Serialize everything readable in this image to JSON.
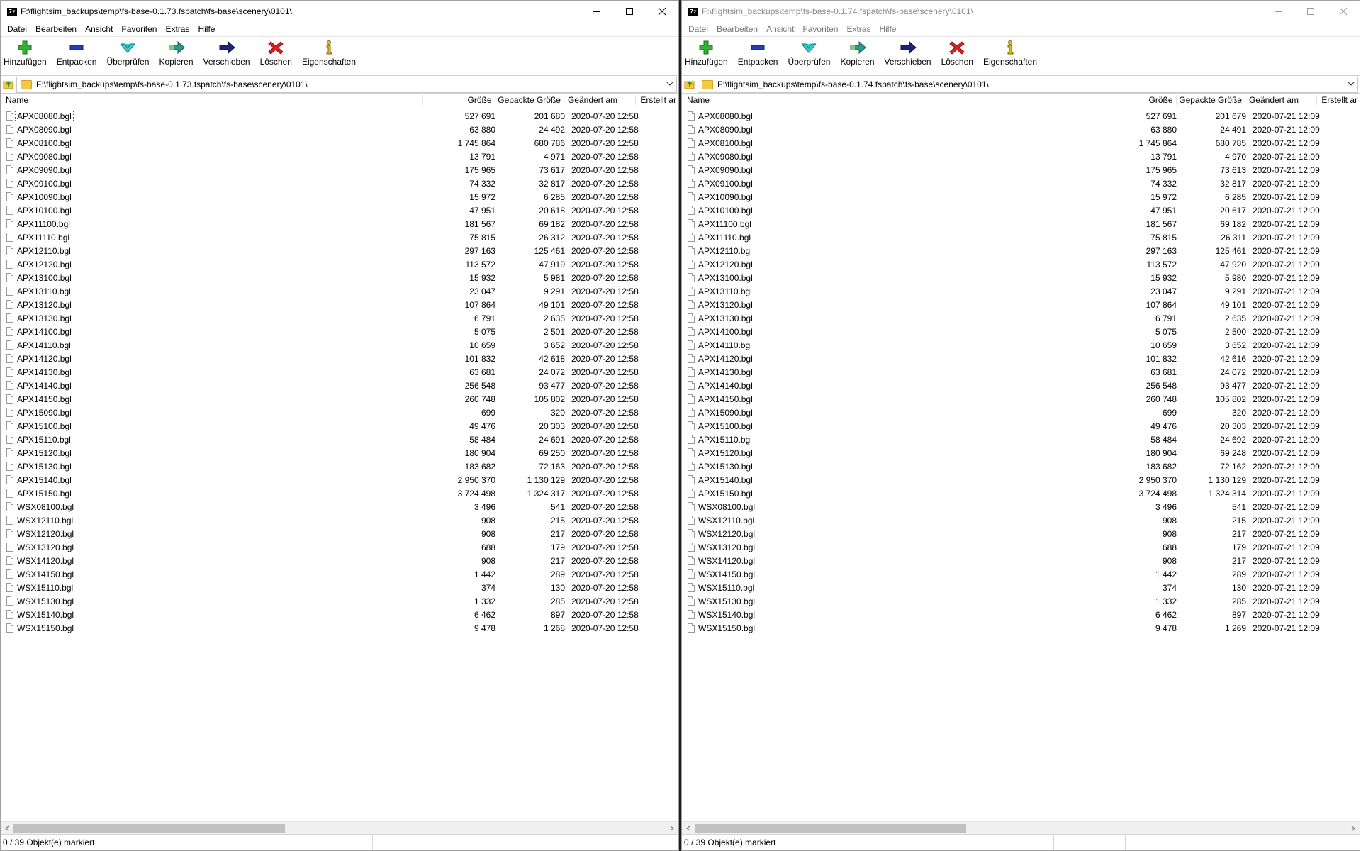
{
  "columns": {
    "name": "Name",
    "size": "Größe",
    "packed": "Gepackte Größe",
    "modified": "Geändert am",
    "created": "Erstellt ar"
  },
  "menu": [
    "Datei",
    "Bearbeiten",
    "Ansicht",
    "Favoriten",
    "Extras",
    "Hilfe"
  ],
  "toolbar": [
    "Hinzufügen",
    "Entpacken",
    "Überprüfen",
    "Kopieren",
    "Verschieben",
    "Löschen",
    "Eigenschaften"
  ],
  "app_icon_text": "7z",
  "left": {
    "title": "F:\\flightsim_backups\\temp\\fs-base-0.1.73.fspatch\\fs-base\\scenery\\0101\\",
    "address": "F:\\flightsim_backups\\temp\\fs-base-0.1.73.fspatch\\fs-base\\scenery\\0101\\",
    "status": "0 / 39 Objekt(e) markiert",
    "rows": [
      [
        "APX08080.bgl",
        "527 691",
        "201 680",
        "2020-07-20 12:58"
      ],
      [
        "APX08090.bgl",
        "63 880",
        "24 492",
        "2020-07-20 12:58"
      ],
      [
        "APX08100.bgl",
        "1 745 864",
        "680 786",
        "2020-07-20 12:58"
      ],
      [
        "APX09080.bgl",
        "13 791",
        "4 971",
        "2020-07-20 12:58"
      ],
      [
        "APX09090.bgl",
        "175 965",
        "73 617",
        "2020-07-20 12:58"
      ],
      [
        "APX09100.bgl",
        "74 332",
        "32 817",
        "2020-07-20 12:58"
      ],
      [
        "APX10090.bgl",
        "15 972",
        "6 285",
        "2020-07-20 12:58"
      ],
      [
        "APX10100.bgl",
        "47 951",
        "20 618",
        "2020-07-20 12:58"
      ],
      [
        "APX11100.bgl",
        "181 567",
        "69 182",
        "2020-07-20 12:58"
      ],
      [
        "APX11110.bgl",
        "75 815",
        "26 312",
        "2020-07-20 12:58"
      ],
      [
        "APX12110.bgl",
        "297 163",
        "125 461",
        "2020-07-20 12:58"
      ],
      [
        "APX12120.bgl",
        "113 572",
        "47 919",
        "2020-07-20 12:58"
      ],
      [
        "APX13100.bgl",
        "15 932",
        "5 981",
        "2020-07-20 12:58"
      ],
      [
        "APX13110.bgl",
        "23 047",
        "9 291",
        "2020-07-20 12:58"
      ],
      [
        "APX13120.bgl",
        "107 864",
        "49 101",
        "2020-07-20 12:58"
      ],
      [
        "APX13130.bgl",
        "6 791",
        "2 635",
        "2020-07-20 12:58"
      ],
      [
        "APX14100.bgl",
        "5 075",
        "2 501",
        "2020-07-20 12:58"
      ],
      [
        "APX14110.bgl",
        "10 659",
        "3 652",
        "2020-07-20 12:58"
      ],
      [
        "APX14120.bgl",
        "101 832",
        "42 618",
        "2020-07-20 12:58"
      ],
      [
        "APX14130.bgl",
        "63 681",
        "24 072",
        "2020-07-20 12:58"
      ],
      [
        "APX14140.bgl",
        "256 548",
        "93 477",
        "2020-07-20 12:58"
      ],
      [
        "APX14150.bgl",
        "260 748",
        "105 802",
        "2020-07-20 12:58"
      ],
      [
        "APX15090.bgl",
        "699",
        "320",
        "2020-07-20 12:58"
      ],
      [
        "APX15100.bgl",
        "49 476",
        "20 303",
        "2020-07-20 12:58"
      ],
      [
        "APX15110.bgl",
        "58 484",
        "24 691",
        "2020-07-20 12:58"
      ],
      [
        "APX15120.bgl",
        "180 904",
        "69 250",
        "2020-07-20 12:58"
      ],
      [
        "APX15130.bgl",
        "183 682",
        "72 163",
        "2020-07-20 12:58"
      ],
      [
        "APX15140.bgl",
        "2 950 370",
        "1 130 129",
        "2020-07-20 12:58"
      ],
      [
        "APX15150.bgl",
        "3 724 498",
        "1 324 317",
        "2020-07-20 12:58"
      ],
      [
        "WSX08100.bgl",
        "3 496",
        "541",
        "2020-07-20 12:58"
      ],
      [
        "WSX12110.bgl",
        "908",
        "215",
        "2020-07-20 12:58"
      ],
      [
        "WSX12120.bgl",
        "908",
        "217",
        "2020-07-20 12:58"
      ],
      [
        "WSX13120.bgl",
        "688",
        "179",
        "2020-07-20 12:58"
      ],
      [
        "WSX14120.bgl",
        "908",
        "217",
        "2020-07-20 12:58"
      ],
      [
        "WSX14150.bgl",
        "1 442",
        "289",
        "2020-07-20 12:58"
      ],
      [
        "WSX15110.bgl",
        "374",
        "130",
        "2020-07-20 12:58"
      ],
      [
        "WSX15130.bgl",
        "1 332",
        "285",
        "2020-07-20 12:58"
      ],
      [
        "WSX15140.bgl",
        "6 462",
        "897",
        "2020-07-20 12:58"
      ],
      [
        "WSX15150.bgl",
        "9 478",
        "1 268",
        "2020-07-20 12:58"
      ]
    ]
  },
  "right": {
    "title": "F:\\flightsim_backups\\temp\\fs-base-0.1.74.fspatch\\fs-base\\scenery\\0101\\",
    "address": "F:\\flightsim_backups\\temp\\fs-base-0.1.74.fspatch\\fs-base\\scenery\\0101\\",
    "status": "0 / 39 Objekt(e) markiert",
    "rows": [
      [
        "APX08080.bgl",
        "527 691",
        "201 679",
        "2020-07-21 12:09"
      ],
      [
        "APX08090.bgl",
        "63 880",
        "24 491",
        "2020-07-21 12:09"
      ],
      [
        "APX08100.bgl",
        "1 745 864",
        "680 785",
        "2020-07-21 12:09"
      ],
      [
        "APX09080.bgl",
        "13 791",
        "4 970",
        "2020-07-21 12:09"
      ],
      [
        "APX09090.bgl",
        "175 965",
        "73 613",
        "2020-07-21 12:09"
      ],
      [
        "APX09100.bgl",
        "74 332",
        "32 817",
        "2020-07-21 12:09"
      ],
      [
        "APX10090.bgl",
        "15 972",
        "6 285",
        "2020-07-21 12:09"
      ],
      [
        "APX10100.bgl",
        "47 951",
        "20 617",
        "2020-07-21 12:09"
      ],
      [
        "APX11100.bgl",
        "181 567",
        "69 182",
        "2020-07-21 12:09"
      ],
      [
        "APX11110.bgl",
        "75 815",
        "26 311",
        "2020-07-21 12:09"
      ],
      [
        "APX12110.bgl",
        "297 163",
        "125 461",
        "2020-07-21 12:09"
      ],
      [
        "APX12120.bgl",
        "113 572",
        "47 920",
        "2020-07-21 12:09"
      ],
      [
        "APX13100.bgl",
        "15 932",
        "5 980",
        "2020-07-21 12:09"
      ],
      [
        "APX13110.bgl",
        "23 047",
        "9 291",
        "2020-07-21 12:09"
      ],
      [
        "APX13120.bgl",
        "107 864",
        "49 101",
        "2020-07-21 12:09"
      ],
      [
        "APX13130.bgl",
        "6 791",
        "2 635",
        "2020-07-21 12:09"
      ],
      [
        "APX14100.bgl",
        "5 075",
        "2 500",
        "2020-07-21 12:09"
      ],
      [
        "APX14110.bgl",
        "10 659",
        "3 652",
        "2020-07-21 12:09"
      ],
      [
        "APX14120.bgl",
        "101 832",
        "42 616",
        "2020-07-21 12:09"
      ],
      [
        "APX14130.bgl",
        "63 681",
        "24 072",
        "2020-07-21 12:09"
      ],
      [
        "APX14140.bgl",
        "256 548",
        "93 477",
        "2020-07-21 12:09"
      ],
      [
        "APX14150.bgl",
        "260 748",
        "105 802",
        "2020-07-21 12:09"
      ],
      [
        "APX15090.bgl",
        "699",
        "320",
        "2020-07-21 12:09"
      ],
      [
        "APX15100.bgl",
        "49 476",
        "20 303",
        "2020-07-21 12:09"
      ],
      [
        "APX15110.bgl",
        "58 484",
        "24 692",
        "2020-07-21 12:09"
      ],
      [
        "APX15120.bgl",
        "180 904",
        "69 248",
        "2020-07-21 12:09"
      ],
      [
        "APX15130.bgl",
        "183 682",
        "72 162",
        "2020-07-21 12:09"
      ],
      [
        "APX15140.bgl",
        "2 950 370",
        "1 130 129",
        "2020-07-21 12:09"
      ],
      [
        "APX15150.bgl",
        "3 724 498",
        "1 324 314",
        "2020-07-21 12:09"
      ],
      [
        "WSX08100.bgl",
        "3 496",
        "541",
        "2020-07-21 12:09"
      ],
      [
        "WSX12110.bgl",
        "908",
        "215",
        "2020-07-21 12:09"
      ],
      [
        "WSX12120.bgl",
        "908",
        "217",
        "2020-07-21 12:09"
      ],
      [
        "WSX13120.bgl",
        "688",
        "179",
        "2020-07-21 12:09"
      ],
      [
        "WSX14120.bgl",
        "908",
        "217",
        "2020-07-21 12:09"
      ],
      [
        "WSX14150.bgl",
        "1 442",
        "289",
        "2020-07-21 12:09"
      ],
      [
        "WSX15110.bgl",
        "374",
        "130",
        "2020-07-21 12:09"
      ],
      [
        "WSX15130.bgl",
        "1 332",
        "285",
        "2020-07-21 12:09"
      ],
      [
        "WSX15140.bgl",
        "6 462",
        "897",
        "2020-07-21 12:09"
      ],
      [
        "WSX15150.bgl",
        "9 478",
        "1 269",
        "2020-07-21 12:09"
      ]
    ]
  }
}
